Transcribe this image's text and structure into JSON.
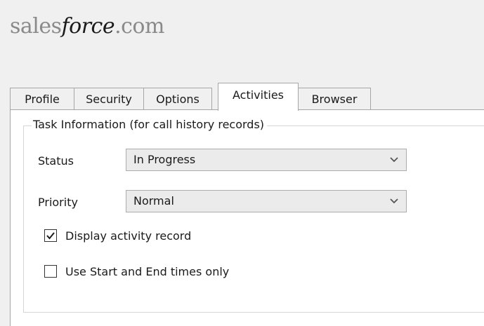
{
  "logo": {
    "part1": "sales",
    "part2": "force",
    "part3": ".com"
  },
  "tabs": [
    {
      "label": "Profile",
      "active": false
    },
    {
      "label": "Security",
      "active": false
    },
    {
      "label": "Options",
      "active": false
    },
    {
      "label": "Activities",
      "active": true
    },
    {
      "label": "Browser",
      "active": false
    }
  ],
  "task_group": {
    "legend": "Task Information (for call history records)",
    "status": {
      "label": "Status",
      "value": "In Progress"
    },
    "priority": {
      "label": "Priority",
      "value": "Normal"
    },
    "display_activity": {
      "label": "Display activity record",
      "checked": true
    },
    "start_end_only": {
      "label": "Use Start and End times only",
      "checked": false
    }
  },
  "icons": {
    "dropdown": "chevron-down-icon",
    "checkmark": "checkmark-icon"
  },
  "colors": {
    "window_bg": "#f0f0f0",
    "panel_bg": "#ffffff",
    "select_bg": "#ebebeb",
    "border": "#a6a6a6"
  }
}
